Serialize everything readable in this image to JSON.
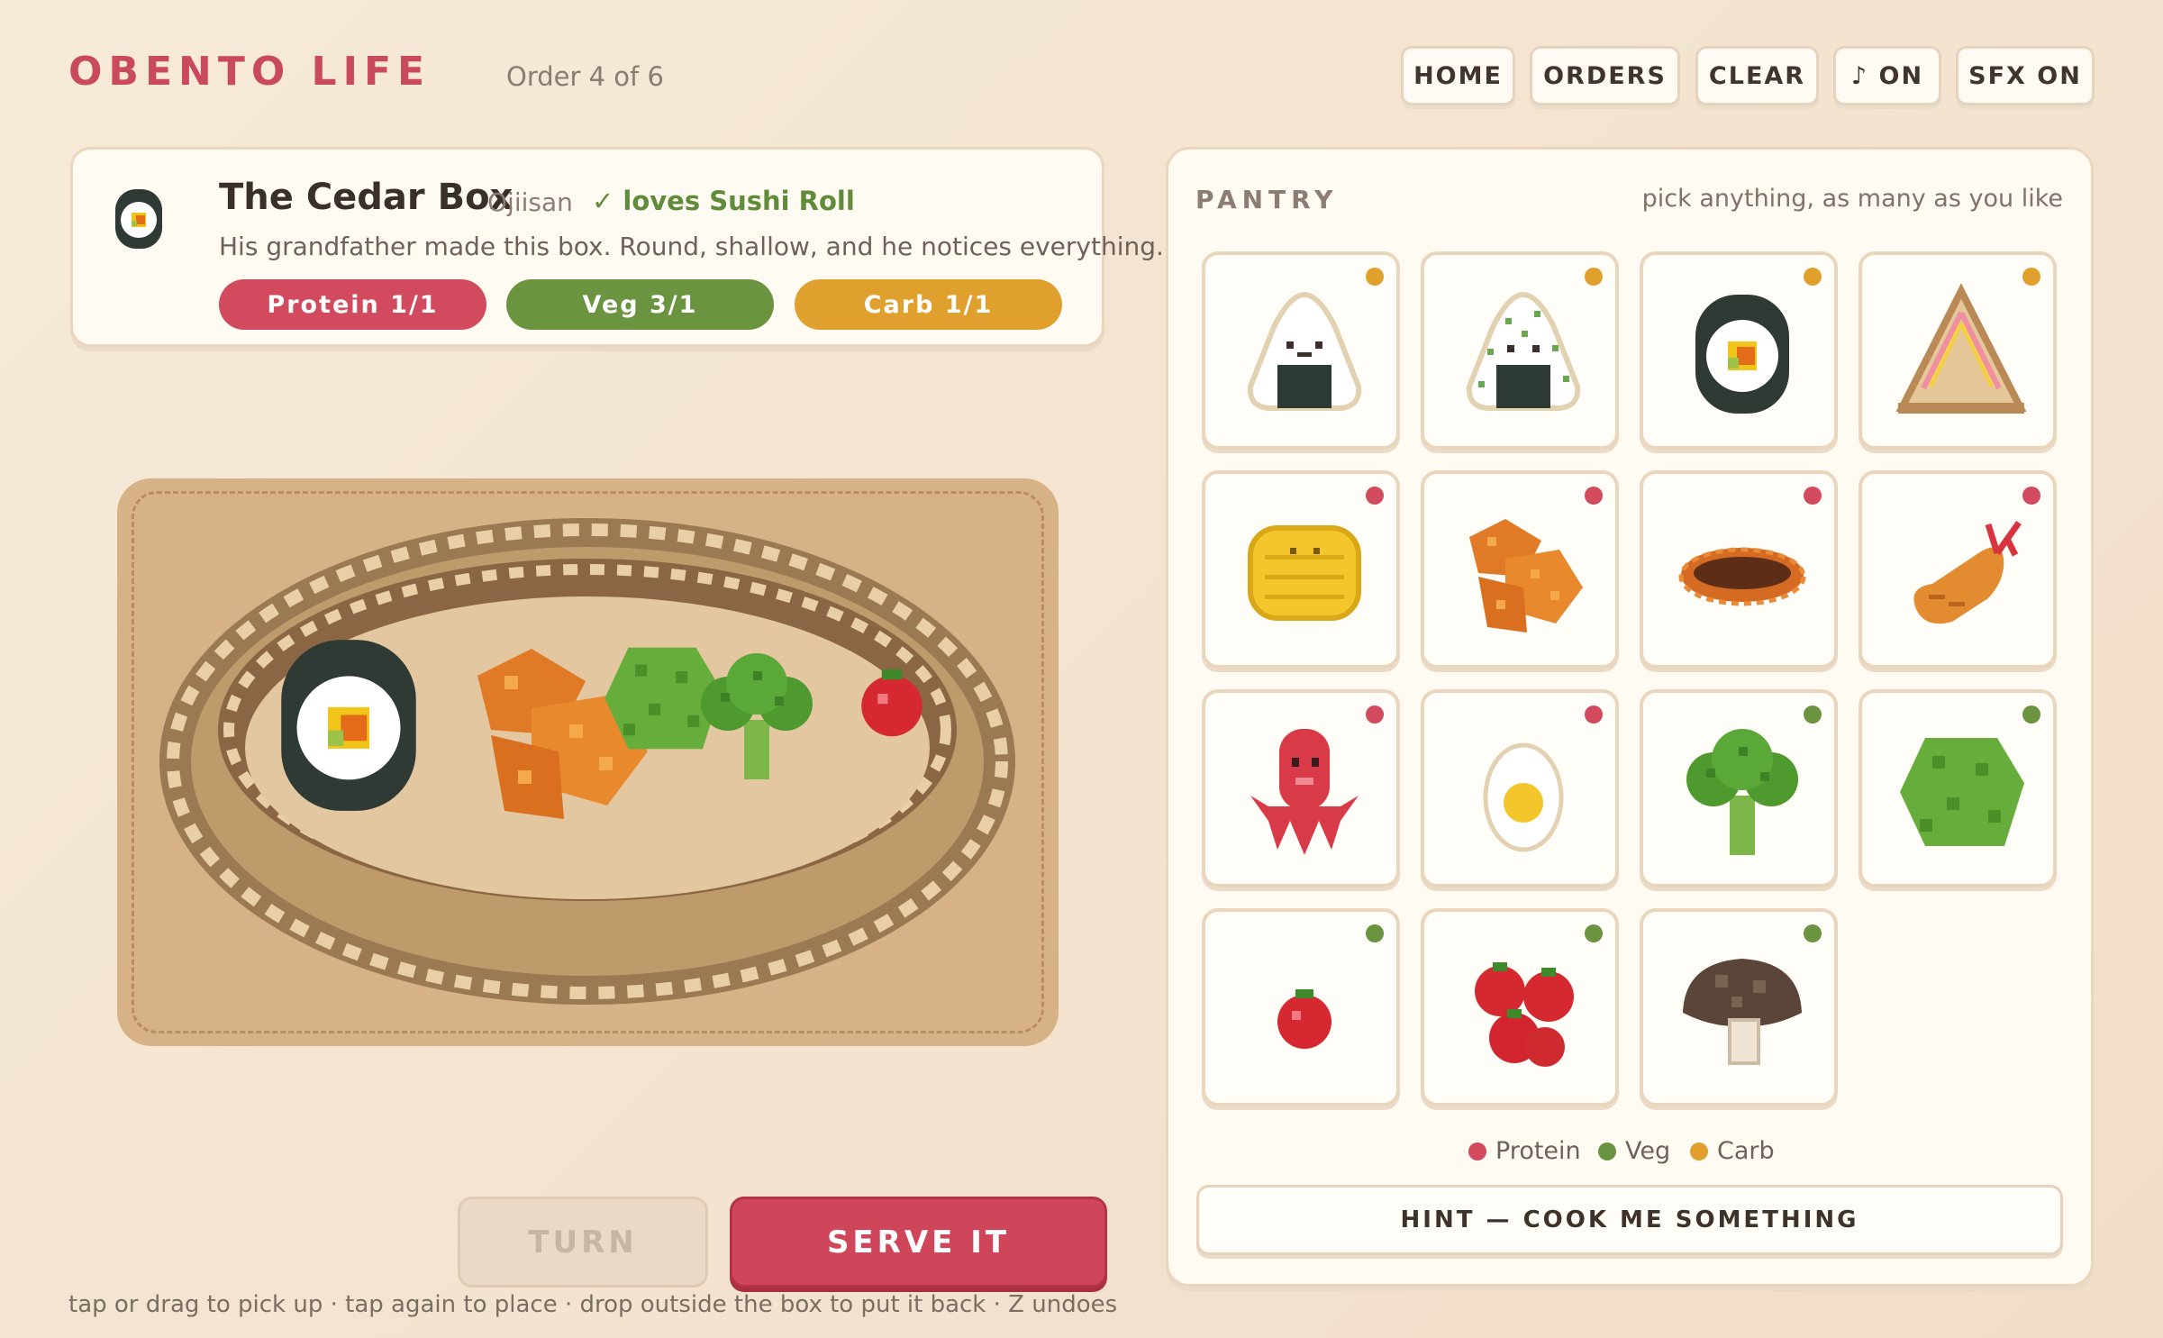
{
  "header": {
    "title": "OBENTO LIFE",
    "order_progress": "Order 4 of 6",
    "buttons": [
      {
        "label": "HOME"
      },
      {
        "label": "ORDERS"
      },
      {
        "label": "CLEAR"
      },
      {
        "label": "♪ ON"
      },
      {
        "label": "SFX ON"
      }
    ]
  },
  "order_card": {
    "icon": "sushi-roll-icon",
    "box_name": "The Cedar Box",
    "customer": "Ojiisan",
    "preference": "✓ loves Sushi Roll",
    "description": "His grandfather made this box. Round, shallow, and he notices everything.",
    "requirements": [
      {
        "label": "Protein   1/1",
        "color": "#d14a5d"
      },
      {
        "label": "Veg   3/1",
        "color": "#6b9440"
      },
      {
        "label": "Carb   1/1",
        "color": "#e0a02e"
      }
    ]
  },
  "bento_box": {
    "shape": "round shallow cedar box",
    "contents": [
      "sushi-roll",
      "karaage",
      "lettuce",
      "broccoli",
      "tomato"
    ]
  },
  "actions": {
    "turn_label": "TURN",
    "serve_label": "SERVE IT"
  },
  "help_text": "tap or drag to pick up  ·  tap again to place  ·  drop outside the box to put it back  ·  Z undoes",
  "pantry": {
    "title": "PANTRY",
    "hint": "pick anything, as many as you like",
    "items": [
      {
        "name": "onigiri",
        "category": "carb"
      },
      {
        "name": "furikake-onigiri",
        "category": "carb"
      },
      {
        "name": "sushi-roll",
        "category": "carb"
      },
      {
        "name": "sandwich",
        "category": "carb"
      },
      {
        "name": "tamagoyaki",
        "category": "protein"
      },
      {
        "name": "karaage",
        "category": "protein"
      },
      {
        "name": "hamburg-steak",
        "category": "protein"
      },
      {
        "name": "ebi-fry",
        "category": "protein"
      },
      {
        "name": "octopus-sausage",
        "category": "protein"
      },
      {
        "name": "boiled-egg",
        "category": "protein"
      },
      {
        "name": "broccoli",
        "category": "veg"
      },
      {
        "name": "lettuce",
        "category": "veg"
      },
      {
        "name": "cherry-tomato",
        "category": "veg"
      },
      {
        "name": "tomatoes",
        "category": "veg"
      },
      {
        "name": "shiitake",
        "category": "veg"
      }
    ],
    "legend": [
      {
        "label": "Protein",
        "color": "#d14a5d"
      },
      {
        "label": "Veg",
        "color": "#6b9440"
      },
      {
        "label": "Carb",
        "color": "#e0a02e"
      }
    ],
    "hint_button": "HINT  —  COOK ME SOMETHING"
  }
}
